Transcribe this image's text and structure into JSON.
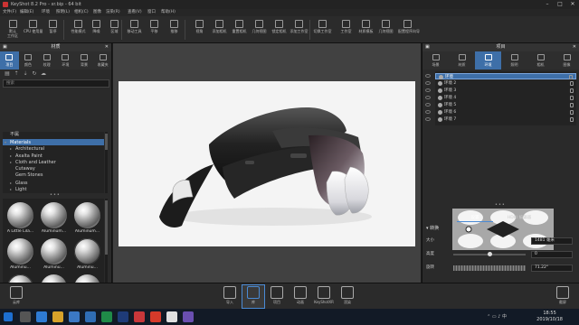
{
  "window": {
    "title": "KeyShot 8.2 Pro  -  xr.bip  -  64 bit"
  },
  "menu": [
    "文件(F)",
    "编辑(E)",
    "环境",
    "照明(L)",
    "相机(C)",
    "图像",
    "渲染(R)",
    "查看(V)",
    "窗口",
    "帮助(H)"
  ],
  "toolbar": {
    "items": [
      {
        "l1": "默认",
        "l2": "工作区",
        "name": "workspace-button"
      },
      {
        "l1": "",
        "l2": "CPU 使用量",
        "name": "cpu-usage-button"
      },
      {
        "l1": "",
        "l2": "暂停",
        "name": "pause-button"
      },
      {
        "l1": "",
        "l2": "性能模式",
        "name": "performance-mode-button"
      },
      {
        "l1": "",
        "l2": "降噪",
        "name": "denoise-button"
      },
      {
        "l1": "",
        "l2": "区域",
        "name": "region-button"
      },
      {
        "l1": "",
        "l2": "移动工具",
        "name": "move-tool-button"
      },
      {
        "l1": "",
        "l2": "平移",
        "name": "pan-button"
      },
      {
        "l1": "",
        "l2": "推移",
        "name": "dolly-button"
      },
      {
        "l1": "",
        "l2": "视角",
        "name": "perspective-button"
      },
      {
        "l1": "",
        "l2": "添加相机",
        "name": "add-camera-button"
      },
      {
        "l1": "",
        "l2": "重置相机",
        "name": "reset-camera-button"
      },
      {
        "l1": "",
        "l2": "几何视图",
        "name": "geometry-view-button"
      },
      {
        "l1": "",
        "l2": "锁定相机",
        "name": "lock-camera-button"
      },
      {
        "l1": "",
        "l2": "添加工作室",
        "name": "add-studio-button"
      },
      {
        "l1": "",
        "l2": "切换工作室",
        "name": "switch-studio-button"
      },
      {
        "l1": "",
        "l2": "工作室",
        "name": "studio-button"
      },
      {
        "l1": "",
        "l2": "材质模板",
        "name": "material-template-button"
      },
      {
        "l1": "",
        "l2": "几何视图",
        "name": "geometry-view-button-2"
      },
      {
        "l1": "",
        "l2": "配置程序向导",
        "name": "configurator-wizard-button"
      }
    ]
  },
  "left_panel": {
    "title": "材质",
    "tabs": [
      "项目",
      "颜色",
      "纹理",
      "环境",
      "背景",
      "收藏夹"
    ],
    "active_tab": 0,
    "search_placeholder": "搜索",
    "tree": [
      {
        "label": "不属",
        "sel": false,
        "indent": 0,
        "arrow": ""
      },
      {
        "label": "Materials",
        "sel": true,
        "indent": 0,
        "arrow": "▾"
      },
      {
        "label": "Architectural",
        "sel": false,
        "indent": 1,
        "arrow": "▸"
      },
      {
        "label": "Axalta Paint",
        "sel": false,
        "indent": 1,
        "arrow": "▸"
      },
      {
        "label": "Cloth and Leather",
        "sel": false,
        "indent": 1,
        "arrow": "▸"
      },
      {
        "label": "Cutaway",
        "sel": false,
        "indent": 1,
        "arrow": ""
      },
      {
        "label": "Gem Stones",
        "sel": false,
        "indent": 1,
        "arrow": ""
      },
      {
        "label": "Glass",
        "sel": false,
        "indent": 1,
        "arrow": "▸"
      },
      {
        "label": "Light",
        "sel": false,
        "indent": 1,
        "arrow": "▸"
      }
    ],
    "materials": [
      {
        "label": "A Little Lila...",
        "pattern": false
      },
      {
        "label": "Aluminum...",
        "pattern": false
      },
      {
        "label": "Aluminum...",
        "pattern": false
      },
      {
        "label": "Aluminu...",
        "pattern": false
      },
      {
        "label": "Aluminu...",
        "pattern": false
      },
      {
        "label": "Aluminu...",
        "pattern": true
      },
      {
        "label": "Aluminum...",
        "pattern": true
      },
      {
        "label": "Aluminu...",
        "pattern": false
      },
      {
        "label": "Aluminu...",
        "pattern": false
      }
    ]
  },
  "right_panel": {
    "title": "项目",
    "tabs": [
      "场景",
      "材质",
      "环境",
      "照明",
      "相机",
      "图像"
    ],
    "active_tab": 2,
    "env_list": [
      "环境",
      "环境 2",
      "环境 3",
      "环境 4",
      "环境 5",
      "环境 6",
      "环境 7"
    ],
    "selected_env": 0,
    "sub_tabs": [
      "设置",
      "HDRI 编辑器"
    ],
    "section": "转换",
    "props": [
      {
        "k": "大小",
        "v": "1481 毫米",
        "slider": null
      },
      {
        "k": "高度",
        "v": "0",
        "slider": 0.5
      },
      {
        "k": "旋转",
        "v": "71.22°",
        "slider": null
      }
    ]
  },
  "bottom_bar": {
    "left": {
      "label": "云库"
    },
    "items": [
      "导入",
      "库",
      "项目",
      "动画",
      "KeyShotXR",
      "渲染"
    ],
    "active": 1,
    "right": {
      "label": "截屏"
    }
  },
  "taskbar": {
    "time": "18:55",
    "date": "2019/10/18",
    "lang": "中"
  },
  "colors": {
    "accent": "#3e6fa8",
    "bg": "#2a2a2a",
    "canvas": "#f4f4f4"
  }
}
